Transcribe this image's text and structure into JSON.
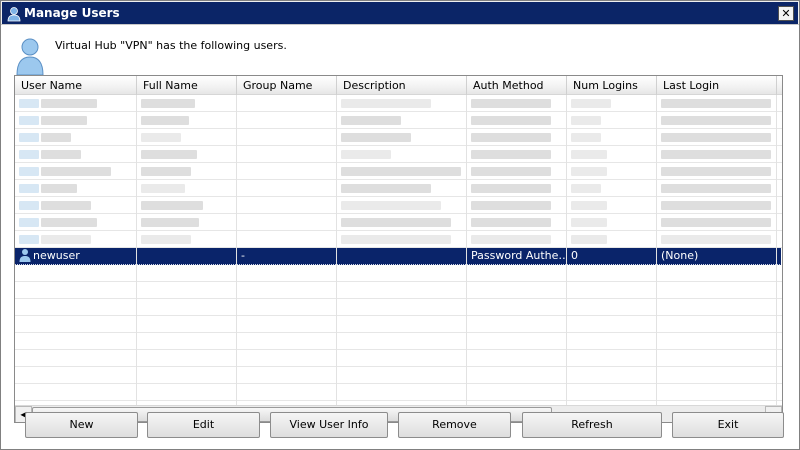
{
  "window": {
    "title": "Manage Users",
    "close_label": "✕"
  },
  "header": {
    "text": "Virtual Hub \"VPN\" has the following users."
  },
  "table": {
    "columns": [
      "User Name",
      "Full Name",
      "Group Name",
      "Description",
      "Auth Method",
      "Num Logins",
      "Last Login"
    ],
    "selected_row": {
      "user_name": "newuser",
      "full_name": "",
      "group_name": "-",
      "description": "",
      "auth_method": "Password Authe…",
      "num_logins": "0",
      "last_login": "(None)"
    }
  },
  "buttons": {
    "new": "New",
    "edit": "Edit",
    "view_user_info": "View User Info",
    "remove": "Remove",
    "refresh": "Refresh",
    "exit": "Exit"
  },
  "colors": {
    "title_bar": "#0b2567",
    "selection": "#0a246a"
  },
  "icons": {
    "title": "user-icon",
    "header": "user-large-icon",
    "row": "user-icon",
    "scroll_left": "arrow-left-icon",
    "scroll_right": "arrow-right-icon"
  }
}
